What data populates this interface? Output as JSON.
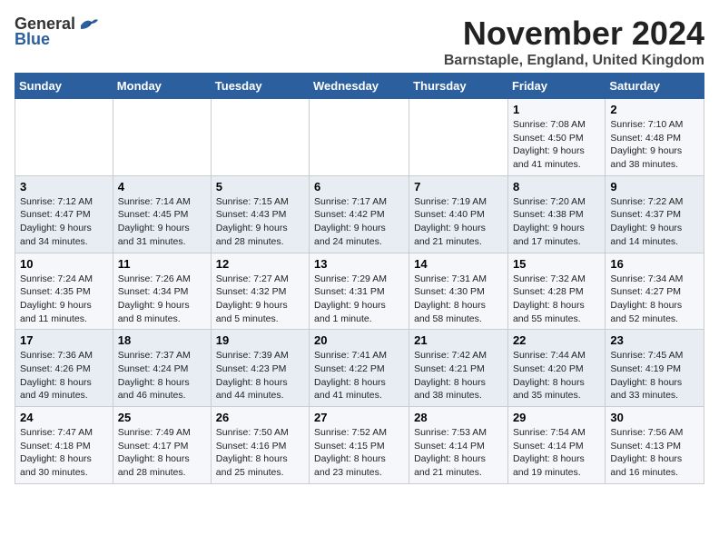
{
  "logo": {
    "general": "General",
    "blue": "Blue"
  },
  "title": "November 2024",
  "location": "Barnstaple, England, United Kingdom",
  "headers": [
    "Sunday",
    "Monday",
    "Tuesday",
    "Wednesday",
    "Thursday",
    "Friday",
    "Saturday"
  ],
  "weeks": [
    [
      {
        "day": "",
        "info": ""
      },
      {
        "day": "",
        "info": ""
      },
      {
        "day": "",
        "info": ""
      },
      {
        "day": "",
        "info": ""
      },
      {
        "day": "",
        "info": ""
      },
      {
        "day": "1",
        "info": "Sunrise: 7:08 AM\nSunset: 4:50 PM\nDaylight: 9 hours and 41 minutes."
      },
      {
        "day": "2",
        "info": "Sunrise: 7:10 AM\nSunset: 4:48 PM\nDaylight: 9 hours and 38 minutes."
      }
    ],
    [
      {
        "day": "3",
        "info": "Sunrise: 7:12 AM\nSunset: 4:47 PM\nDaylight: 9 hours and 34 minutes."
      },
      {
        "day": "4",
        "info": "Sunrise: 7:14 AM\nSunset: 4:45 PM\nDaylight: 9 hours and 31 minutes."
      },
      {
        "day": "5",
        "info": "Sunrise: 7:15 AM\nSunset: 4:43 PM\nDaylight: 9 hours and 28 minutes."
      },
      {
        "day": "6",
        "info": "Sunrise: 7:17 AM\nSunset: 4:42 PM\nDaylight: 9 hours and 24 minutes."
      },
      {
        "day": "7",
        "info": "Sunrise: 7:19 AM\nSunset: 4:40 PM\nDaylight: 9 hours and 21 minutes."
      },
      {
        "day": "8",
        "info": "Sunrise: 7:20 AM\nSunset: 4:38 PM\nDaylight: 9 hours and 17 minutes."
      },
      {
        "day": "9",
        "info": "Sunrise: 7:22 AM\nSunset: 4:37 PM\nDaylight: 9 hours and 14 minutes."
      }
    ],
    [
      {
        "day": "10",
        "info": "Sunrise: 7:24 AM\nSunset: 4:35 PM\nDaylight: 9 hours and 11 minutes."
      },
      {
        "day": "11",
        "info": "Sunrise: 7:26 AM\nSunset: 4:34 PM\nDaylight: 9 hours and 8 minutes."
      },
      {
        "day": "12",
        "info": "Sunrise: 7:27 AM\nSunset: 4:32 PM\nDaylight: 9 hours and 5 minutes."
      },
      {
        "day": "13",
        "info": "Sunrise: 7:29 AM\nSunset: 4:31 PM\nDaylight: 9 hours and 1 minute."
      },
      {
        "day": "14",
        "info": "Sunrise: 7:31 AM\nSunset: 4:30 PM\nDaylight: 8 hours and 58 minutes."
      },
      {
        "day": "15",
        "info": "Sunrise: 7:32 AM\nSunset: 4:28 PM\nDaylight: 8 hours and 55 minutes."
      },
      {
        "day": "16",
        "info": "Sunrise: 7:34 AM\nSunset: 4:27 PM\nDaylight: 8 hours and 52 minutes."
      }
    ],
    [
      {
        "day": "17",
        "info": "Sunrise: 7:36 AM\nSunset: 4:26 PM\nDaylight: 8 hours and 49 minutes."
      },
      {
        "day": "18",
        "info": "Sunrise: 7:37 AM\nSunset: 4:24 PM\nDaylight: 8 hours and 46 minutes."
      },
      {
        "day": "19",
        "info": "Sunrise: 7:39 AM\nSunset: 4:23 PM\nDaylight: 8 hours and 44 minutes."
      },
      {
        "day": "20",
        "info": "Sunrise: 7:41 AM\nSunset: 4:22 PM\nDaylight: 8 hours and 41 minutes."
      },
      {
        "day": "21",
        "info": "Sunrise: 7:42 AM\nSunset: 4:21 PM\nDaylight: 8 hours and 38 minutes."
      },
      {
        "day": "22",
        "info": "Sunrise: 7:44 AM\nSunset: 4:20 PM\nDaylight: 8 hours and 35 minutes."
      },
      {
        "day": "23",
        "info": "Sunrise: 7:45 AM\nSunset: 4:19 PM\nDaylight: 8 hours and 33 minutes."
      }
    ],
    [
      {
        "day": "24",
        "info": "Sunrise: 7:47 AM\nSunset: 4:18 PM\nDaylight: 8 hours and 30 minutes."
      },
      {
        "day": "25",
        "info": "Sunrise: 7:49 AM\nSunset: 4:17 PM\nDaylight: 8 hours and 28 minutes."
      },
      {
        "day": "26",
        "info": "Sunrise: 7:50 AM\nSunset: 4:16 PM\nDaylight: 8 hours and 25 minutes."
      },
      {
        "day": "27",
        "info": "Sunrise: 7:52 AM\nSunset: 4:15 PM\nDaylight: 8 hours and 23 minutes."
      },
      {
        "day": "28",
        "info": "Sunrise: 7:53 AM\nSunset: 4:14 PM\nDaylight: 8 hours and 21 minutes."
      },
      {
        "day": "29",
        "info": "Sunrise: 7:54 AM\nSunset: 4:14 PM\nDaylight: 8 hours and 19 minutes."
      },
      {
        "day": "30",
        "info": "Sunrise: 7:56 AM\nSunset: 4:13 PM\nDaylight: 8 hours and 16 minutes."
      }
    ]
  ]
}
